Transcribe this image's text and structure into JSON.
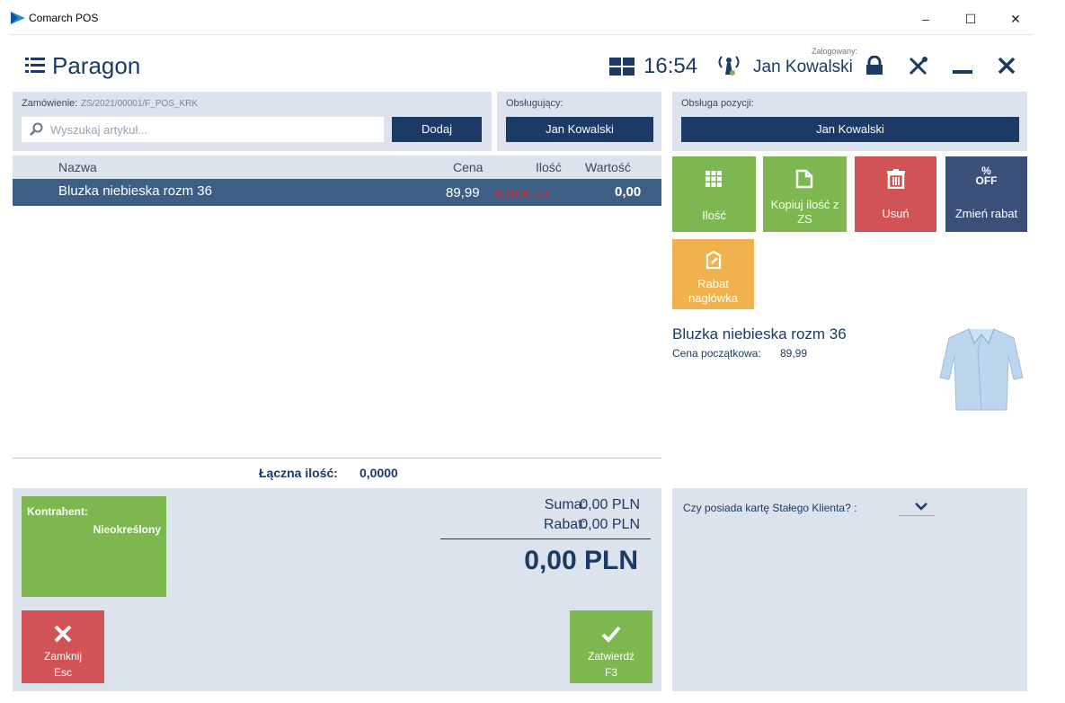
{
  "window": {
    "title": "Comarch POS",
    "min": "–",
    "max": "☐",
    "close": "✕"
  },
  "header": {
    "title": "Paragon",
    "time": "16:54",
    "logged_label": "Zalogowany:",
    "user": "Jan Kowalski"
  },
  "order": {
    "label": "Zamówienie:",
    "number": "ZS/2021/00001/F_POS_KRK",
    "search_placeholder": "Wyszukaj artykuł...",
    "add_button": "Dodaj"
  },
  "served_by": {
    "label": "Obsługujący:",
    "value": "Jan Kowalski"
  },
  "position_handling": {
    "label": "Obsługa pozycji:",
    "value": "Jan Kowalski"
  },
  "table": {
    "headers": {
      "name": "Nazwa",
      "price": "Cena",
      "qty": "Ilość",
      "value": "Wartość"
    },
    "rows": [
      {
        "name": "Bluzka niebieska rozm 36",
        "price": "89,99",
        "qty": "0,0000 szt",
        "value": "0,00"
      }
    ],
    "total_qty_label": "Łączna ilość:",
    "total_qty": "0,0000"
  },
  "actions": {
    "quantity": "Ilość",
    "copy_qty": "Kopiuj ilość z ZS",
    "delete": "Usuń",
    "discount_icon_top": "%",
    "discount_icon_bottom": "OFF",
    "change_discount": "Zmień rabat",
    "header_discount": "Rabat nagłówka"
  },
  "product": {
    "name": "Bluzka niebieska rozm 36",
    "initial_price_label": "Cena początkowa:",
    "initial_price": "89,99"
  },
  "contractor": {
    "label": "Kontrahent:",
    "value": "Nieokreślony"
  },
  "summary": {
    "sum_label": "Suma:",
    "sum": "0,00 PLN",
    "discount_label": "Rabat:",
    "discount": "0,00 PLN",
    "total": "0,00 PLN"
  },
  "footer": {
    "close_label": "Zamknij",
    "close_key": "Esc",
    "confirm_label": "Zatwierdź",
    "confirm_key": "F3"
  },
  "loyalty": {
    "question": "Czy posiada kartę Stałego Klienta? :"
  },
  "colors": {
    "navy": "#1c3a66",
    "green": "#7cb84f",
    "red": "#d15355",
    "orange": "#f0b24c",
    "panel": "#dde3ec"
  }
}
